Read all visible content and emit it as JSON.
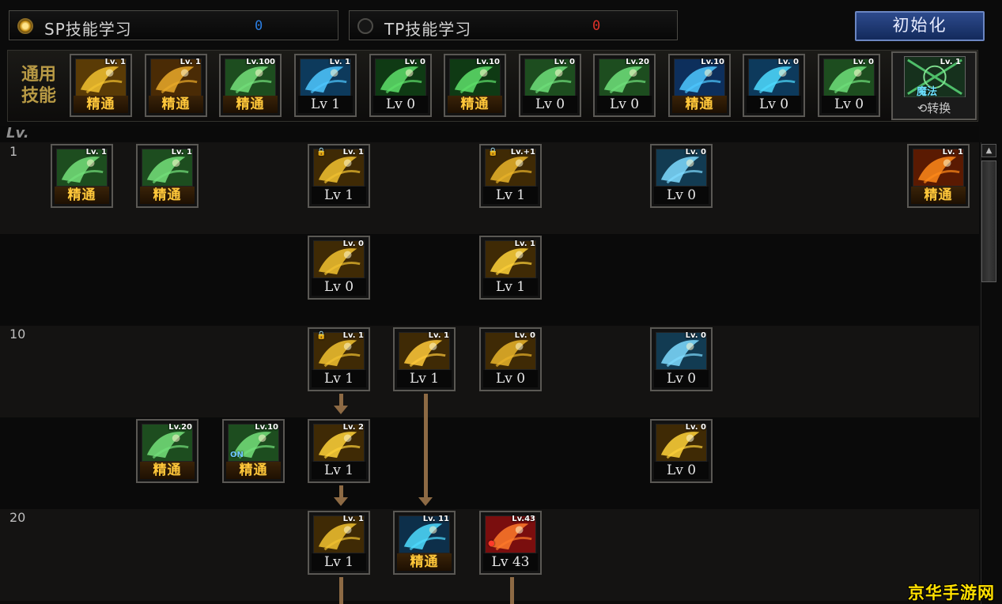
{
  "sp": {
    "label": "SP技能学习",
    "value": "0",
    "value_color": "#2b7de0"
  },
  "tp": {
    "label": "TP技能学习",
    "value": "0",
    "value_color": "#e0322a"
  },
  "reset_label": "初始化",
  "common": {
    "title": "通用技能",
    "skills": [
      {
        "icon": "sprint-skill-icon",
        "tag": "Lv. 1",
        "status": "精通",
        "mastered": true,
        "c1": "#f2c230",
        "c2": "#5a3b06"
      },
      {
        "icon": "leap-skill-icon",
        "tag": "Lv. 1",
        "status": "精通",
        "mastered": true,
        "c1": "#e9a92a",
        "c2": "#4a2b05"
      },
      {
        "icon": "throw-skill-icon",
        "tag": "Lv.100",
        "status": "精通",
        "mastered": true,
        "c1": "#74e07a",
        "c2": "#1d4d1f"
      },
      {
        "icon": "wing-skill-icon",
        "tag": "Lv. 1",
        "status": "Lv 1",
        "mastered": false,
        "c1": "#4fc8ff",
        "c2": "#0d3a5c"
      },
      {
        "icon": "target-skill-icon",
        "tag": "Lv. 0",
        "status": "Lv 0",
        "mastered": false,
        "c1": "#5ee06a",
        "c2": "#0f3a14"
      },
      {
        "icon": "target-focus-skill-icon",
        "tag": "Lv.10",
        "status": "精通",
        "mastered": true,
        "c1": "#5ee06a",
        "c2": "#0f3a14"
      },
      {
        "icon": "creature-skill-icon",
        "tag": "Lv. 0",
        "status": "Lv 0",
        "mastered": false,
        "c1": "#6fe07a",
        "c2": "#1d4d1f"
      },
      {
        "icon": "creature-roar-skill-icon",
        "tag": "Lv.20",
        "status": "Lv 0",
        "mastered": false,
        "c1": "#6fe07a",
        "c2": "#1d4d1f"
      },
      {
        "icon": "eye-skill-icon",
        "tag": "Lv.10",
        "status": "精通",
        "mastered": true,
        "c1": "#4fc8ff",
        "c2": "#0d2f5c"
      },
      {
        "icon": "body-skill-icon",
        "tag": "Lv. 0",
        "status": "Lv 0",
        "mastered": false,
        "c1": "#4fdcff",
        "c2": "#0d3a5c"
      },
      {
        "icon": "arm-skill-icon",
        "tag": "Lv. 0",
        "status": "Lv 0",
        "mastered": false,
        "c1": "#6fe07a",
        "c2": "#1d4d1f"
      }
    ],
    "mode": {
      "tag": "Lv. 1",
      "name": "魔法",
      "switch_label": "转换"
    }
  },
  "tree": {
    "lv_header": "Lv.",
    "row_levels": [
      "1",
      "10",
      "20"
    ],
    "skills": [
      {
        "id": "s1",
        "icon": "scroll-skill-icon",
        "tag": "Lv. 1",
        "status": "精通",
        "mastered": true,
        "c1": "#74e07a",
        "c2": "#1d4d1f"
      },
      {
        "id": "s2",
        "icon": "book-skill-icon",
        "tag": "Lv. 1",
        "status": "精通",
        "mastered": true,
        "c1": "#74e07a",
        "c2": "#1d4d1f"
      },
      {
        "id": "s3",
        "icon": "slash-skill-icon",
        "tag": "Lv. 1",
        "status": "Lv 1",
        "mastered": false,
        "locked": true,
        "c1": "#f2c230",
        "c2": "#3f2a05"
      },
      {
        "id": "s4",
        "icon": "claw-skill-icon",
        "tag": "Lv.+1",
        "status": "Lv 1",
        "mastered": false,
        "locked": true,
        "c1": "#e9b42a",
        "c2": "#3f2a05"
      },
      {
        "id": "s5",
        "icon": "palm-skill-icon",
        "tag": "Lv. 0",
        "status": "Lv 0",
        "mastered": false,
        "c1": "#7fdcff",
        "c2": "#123b52"
      },
      {
        "id": "s6",
        "icon": "fire-skill-icon",
        "tag": "Lv. 1",
        "status": "精通",
        "mastered": true,
        "c1": "#ff8a1a",
        "c2": "#5a1a02"
      },
      {
        "id": "s7",
        "icon": "burst-skill-icon",
        "tag": "Lv. 0",
        "status": "Lv 0",
        "mastered": false,
        "c1": "#f2c230",
        "c2": "#3f2a05"
      },
      {
        "id": "s8",
        "icon": "explosion-skill-icon",
        "tag": "Lv. 1",
        "status": "Lv 1",
        "mastered": false,
        "c1": "#ffd23a",
        "c2": "#3f2a05"
      },
      {
        "id": "s9",
        "icon": "crescent-skill-icon",
        "tag": "Lv. 1",
        "status": "Lv 1",
        "mastered": false,
        "locked": true,
        "c1": "#f2c230",
        "c2": "#3f2a05"
      },
      {
        "id": "s10",
        "icon": "aura-skill-icon",
        "tag": "Lv. 1",
        "status": "Lv 1",
        "mastered": false,
        "c1": "#ffc93a",
        "c2": "#3f2a05"
      },
      {
        "id": "s11",
        "icon": "blade-skill-icon",
        "tag": "Lv. 0",
        "status": "Lv 0",
        "mastered": false,
        "c1": "#e9b42a",
        "c2": "#3f2a05"
      },
      {
        "id": "s12",
        "icon": "rune-skill-icon",
        "tag": "Lv. 0",
        "status": "Lv 0",
        "mastered": false,
        "c1": "#7fdcff",
        "c2": "#123b52"
      },
      {
        "id": "s13",
        "icon": "kick-skill-icon",
        "tag": "Lv.20",
        "status": "精通",
        "mastered": true,
        "c1": "#74e07a",
        "c2": "#1d4d1f"
      },
      {
        "id": "s14",
        "icon": "toggle-skill-icon",
        "tag": "Lv.10",
        "status": "精通",
        "mastered": true,
        "on": "ON",
        "c1": "#74e07a",
        "c2": "#1d4d1f"
      },
      {
        "id": "s15",
        "icon": "spin-skill-icon",
        "tag": "Lv. 2",
        "status": "Lv 1",
        "mastered": false,
        "c1": "#ffd23a",
        "c2": "#3f2a05"
      },
      {
        "id": "s16",
        "icon": "shockwave-skill-icon",
        "tag": "Lv. 0",
        "status": "Lv 0",
        "mastered": false,
        "c1": "#ffd23a",
        "c2": "#3f2a05"
      },
      {
        "id": "s17",
        "icon": "whirl-skill-icon",
        "tag": "Lv. 1",
        "status": "Lv 1",
        "mastered": false,
        "c1": "#f2c230",
        "c2": "#3f2a05"
      },
      {
        "id": "s18",
        "icon": "tree-skill-icon",
        "tag": "Lv. 11",
        "status": "精通",
        "mastered": true,
        "c1": "#4fdcff",
        "c2": "#0d2f4a"
      },
      {
        "id": "s19",
        "icon": "strike-skill-icon",
        "tag": "Lv.43",
        "status": "Lv 43",
        "mastered": false,
        "awakened": true,
        "c1": "#ff7a2a",
        "c2": "#6a0c0c"
      }
    ]
  },
  "scroll_up_label": "▲",
  "watermark": "京华手游网"
}
